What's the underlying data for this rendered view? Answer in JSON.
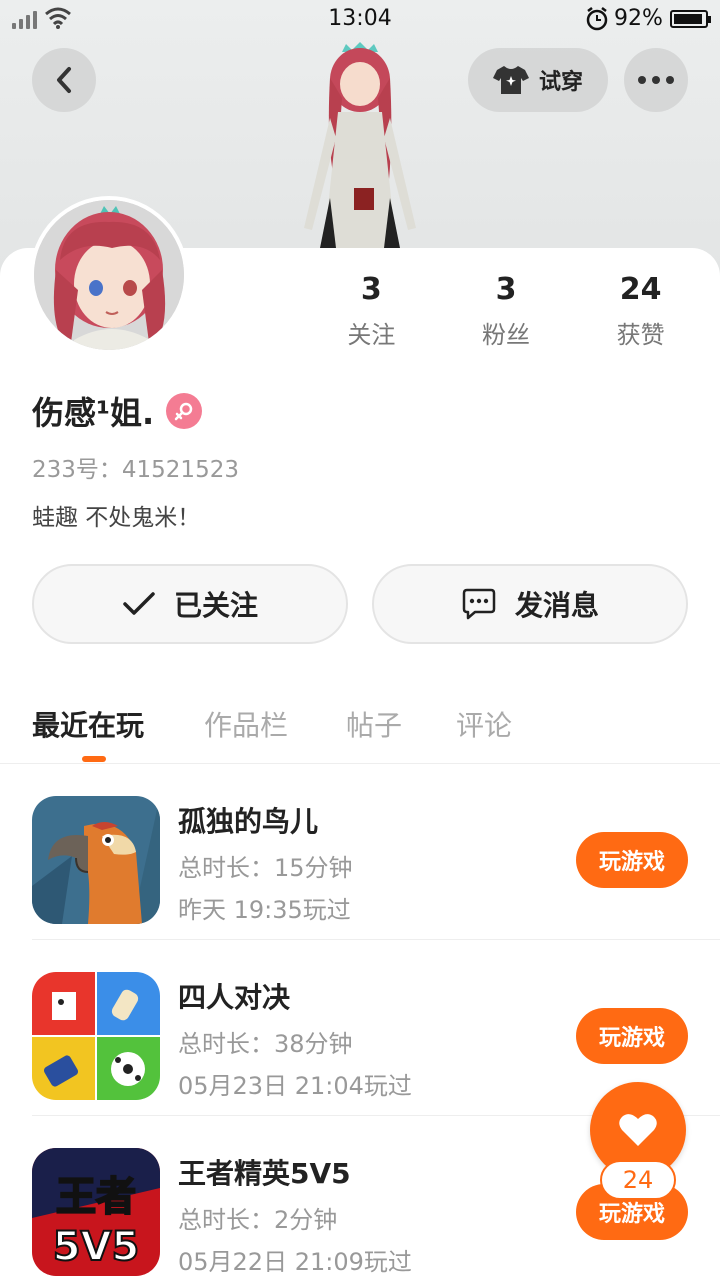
{
  "status_bar": {
    "time": "13:04",
    "battery": "92%",
    "battery_level": 0.92
  },
  "header": {
    "try_on_label": "试穿"
  },
  "profile": {
    "stats": [
      {
        "value": "3",
        "label": "关注"
      },
      {
        "value": "3",
        "label": "粉丝"
      },
      {
        "value": "24",
        "label": "获赞"
      }
    ],
    "username": "伤感¹姐.",
    "user_id": "233号：41521523",
    "bio": "蛙趣 不处鬼米！"
  },
  "actions": {
    "follow_label": "已关注",
    "message_label": "发消息"
  },
  "tabs": [
    {
      "label": "最近在玩",
      "active": true
    },
    {
      "label": "作品栏",
      "active": false
    },
    {
      "label": "帖子",
      "active": false
    },
    {
      "label": "评论",
      "active": false
    }
  ],
  "games": [
    {
      "name": "孤独的鸟儿",
      "duration": "总时长：15分钟",
      "last_played": "昨天 19:35玩过",
      "button": "玩游戏",
      "icon": "parrot-icon"
    },
    {
      "name": "四人对决",
      "duration": "总时长：38分钟",
      "last_played": "05月23日 21:04玩过",
      "button": "玩游戏",
      "icon": "four-player-icon"
    },
    {
      "name": "王者精英5V5",
      "duration": "总时长：2分钟",
      "last_played": "05月22日 21:09玩过",
      "button": "玩游戏",
      "icon": "kings-5v5-icon",
      "icon_text_top": "王者",
      "icon_text_bottom": "5V5"
    }
  ],
  "like": {
    "count": "24"
  },
  "colors": {
    "accent": "#ff6a13",
    "gender_badge": "#f47c93"
  }
}
